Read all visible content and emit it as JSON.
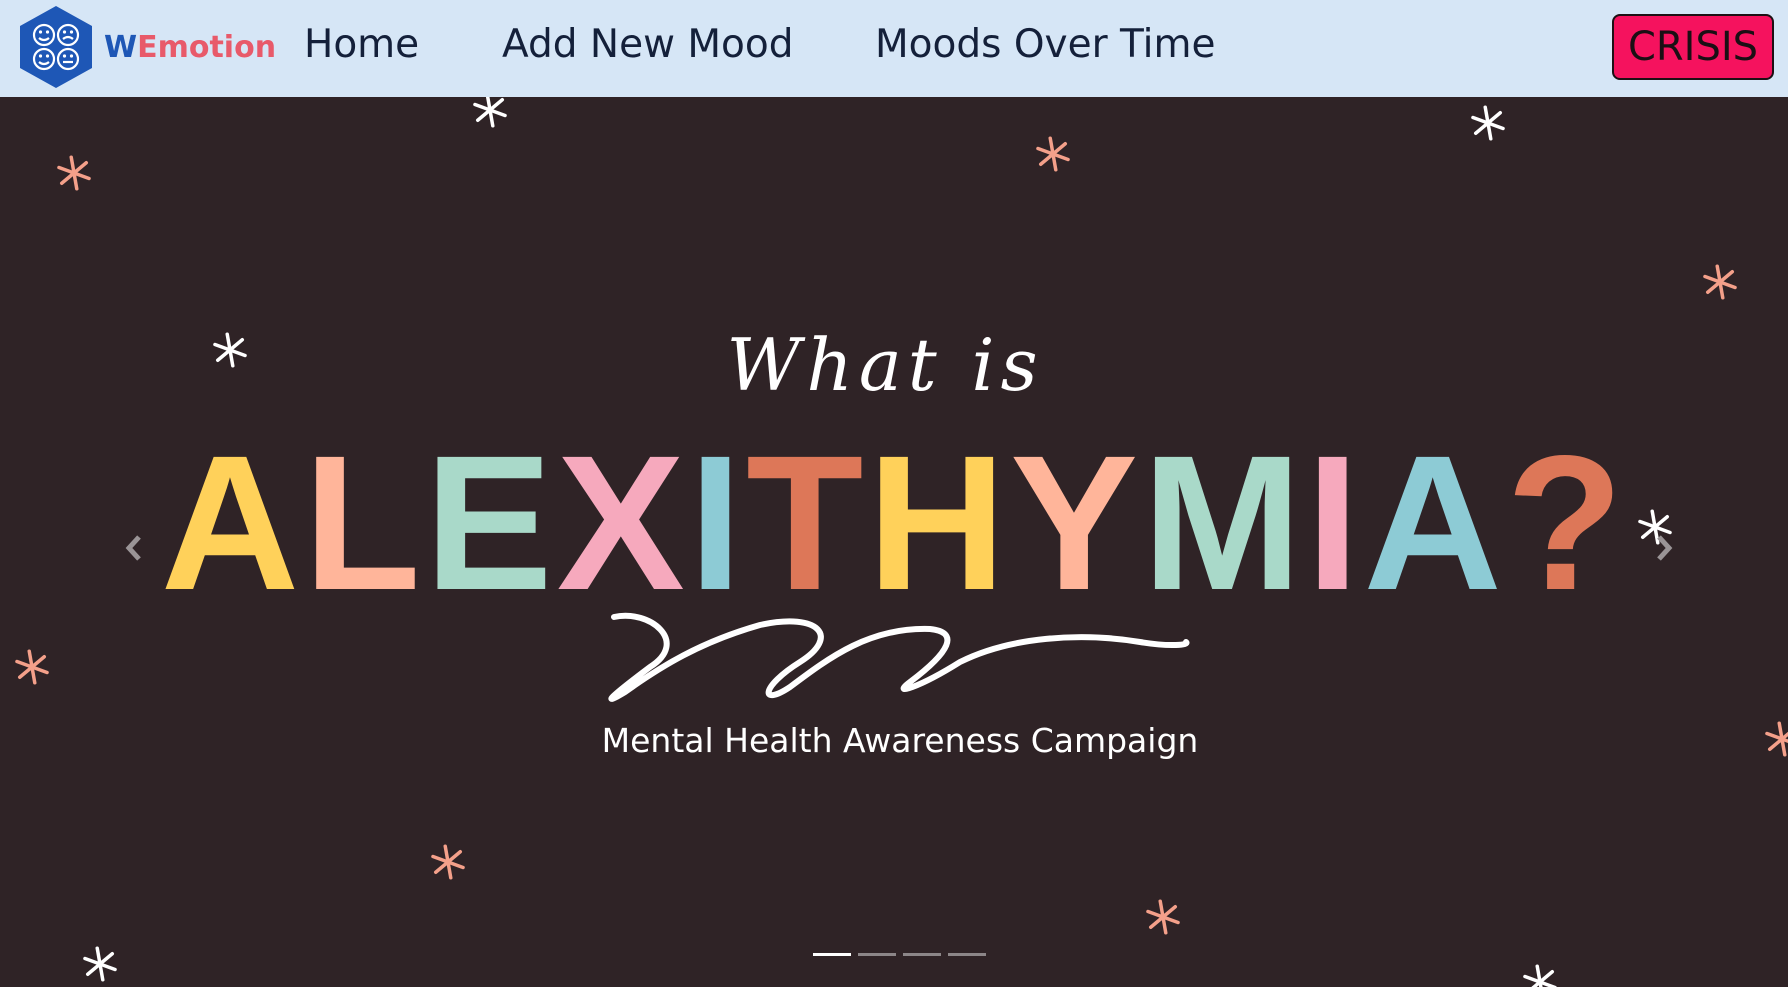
{
  "nav": {
    "brand_w": "W",
    "brand_rest": "Emotion",
    "links": [
      {
        "label": "Home"
      },
      {
        "label": "Add New Mood"
      },
      {
        "label": "Moods Over Time"
      }
    ],
    "crisis_label": "CRISIS"
  },
  "hero": {
    "prefix": "What is",
    "title_letters": [
      "A",
      "L",
      "E",
      "X",
      "I",
      "T",
      "H",
      "Y",
      "M",
      "I",
      "A",
      "?"
    ],
    "subtitle": "Mental Health Awareness Campaign",
    "prev_icon": "chevron-left-icon",
    "next_icon": "chevron-right-icon",
    "slide_count": 4,
    "active_slide": 1
  },
  "colors": {
    "navbar_bg": "#d6e6f6",
    "hero_bg": "#2f2326",
    "crisis_bg": "#f5125e",
    "brand_blue": "#1e57b6",
    "brand_pink": "#e85a6a",
    "yellow": "#ffd15a",
    "peach": "#ffb59a",
    "mint": "#a9d9c9",
    "pink": "#f6a9bd",
    "teal": "#8dcbd5",
    "terracotta": "#dd7758",
    "star_white": "#ffffff",
    "star_peach": "#f4a08a"
  }
}
